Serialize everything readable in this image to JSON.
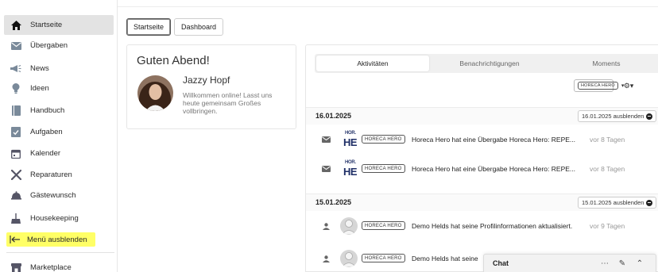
{
  "sidebar": {
    "items": [
      {
        "label": "Startseite",
        "icon": "home-icon"
      },
      {
        "label": "Übergaben",
        "icon": "mail-icon"
      },
      {
        "label": "News",
        "icon": "megaphone-icon"
      },
      {
        "label": "Ideen",
        "icon": "lightbulb-icon"
      },
      {
        "label": "Handbuch",
        "icon": "book-icon"
      },
      {
        "label": "Aufgaben",
        "icon": "task-icon"
      },
      {
        "label": "Kalender",
        "icon": "calendar-icon"
      },
      {
        "label": "Reparaturen",
        "icon": "tools-icon"
      },
      {
        "label": "Gästewunsch",
        "icon": "bell-icon"
      },
      {
        "label": "Housekeeping",
        "icon": "broom-icon"
      }
    ],
    "hide_menu_label": "Menü ausblenden",
    "marketplace_label": "Marketplace"
  },
  "top_tabs": [
    "Startseite",
    "Dashboard"
  ],
  "greeting": {
    "title": "Guten Abend!",
    "name": "Jazzy Hopf",
    "message": "Willkommen online! Lasst uns heute gemeinsam Großes vollbringen."
  },
  "panel": {
    "tabs": [
      "Aktivitäten",
      "Benachrichtigungen",
      "Moments"
    ],
    "filter_value": "HORECA HERO",
    "gear_label": "⚙▾",
    "groups": [
      {
        "date": "16.01.2025",
        "hide_label": "16.01.2025 ausblenden",
        "items": [
          {
            "tag": "HORECA HERO",
            "text": "Horeca Hero hat eine Übergabe Horeca Hero: REPE...",
            "time": "vor 8 Tagen"
          },
          {
            "tag": "HORECA HERO",
            "text": "Horeca Hero hat eine Übergabe Horeca Hero: REPE...",
            "time": "vor 8 Tagen"
          }
        ]
      },
      {
        "date": "15.01.2025",
        "hide_label": "15.01.2025 ausblenden",
        "items": [
          {
            "tag": "HORECA HERO",
            "text": "Demo Helds hat seine Profilinformationen aktualisiert.",
            "time": "vor 9 Tagen"
          },
          {
            "tag": "HORECA HERO",
            "text": "Demo Helds hat seine",
            "time": ""
          }
        ]
      }
    ],
    "logo_small": "HOR.",
    "logo_big": "HE"
  },
  "chat": {
    "title": "Chat",
    "more_icon": "⋯",
    "edit_icon": "✎",
    "collapse_icon": "⌃"
  },
  "colors": {
    "highlight": "#ffff66",
    "active_nav_bg": "#e3e3e3",
    "logo_blue": "#1e2e66"
  }
}
